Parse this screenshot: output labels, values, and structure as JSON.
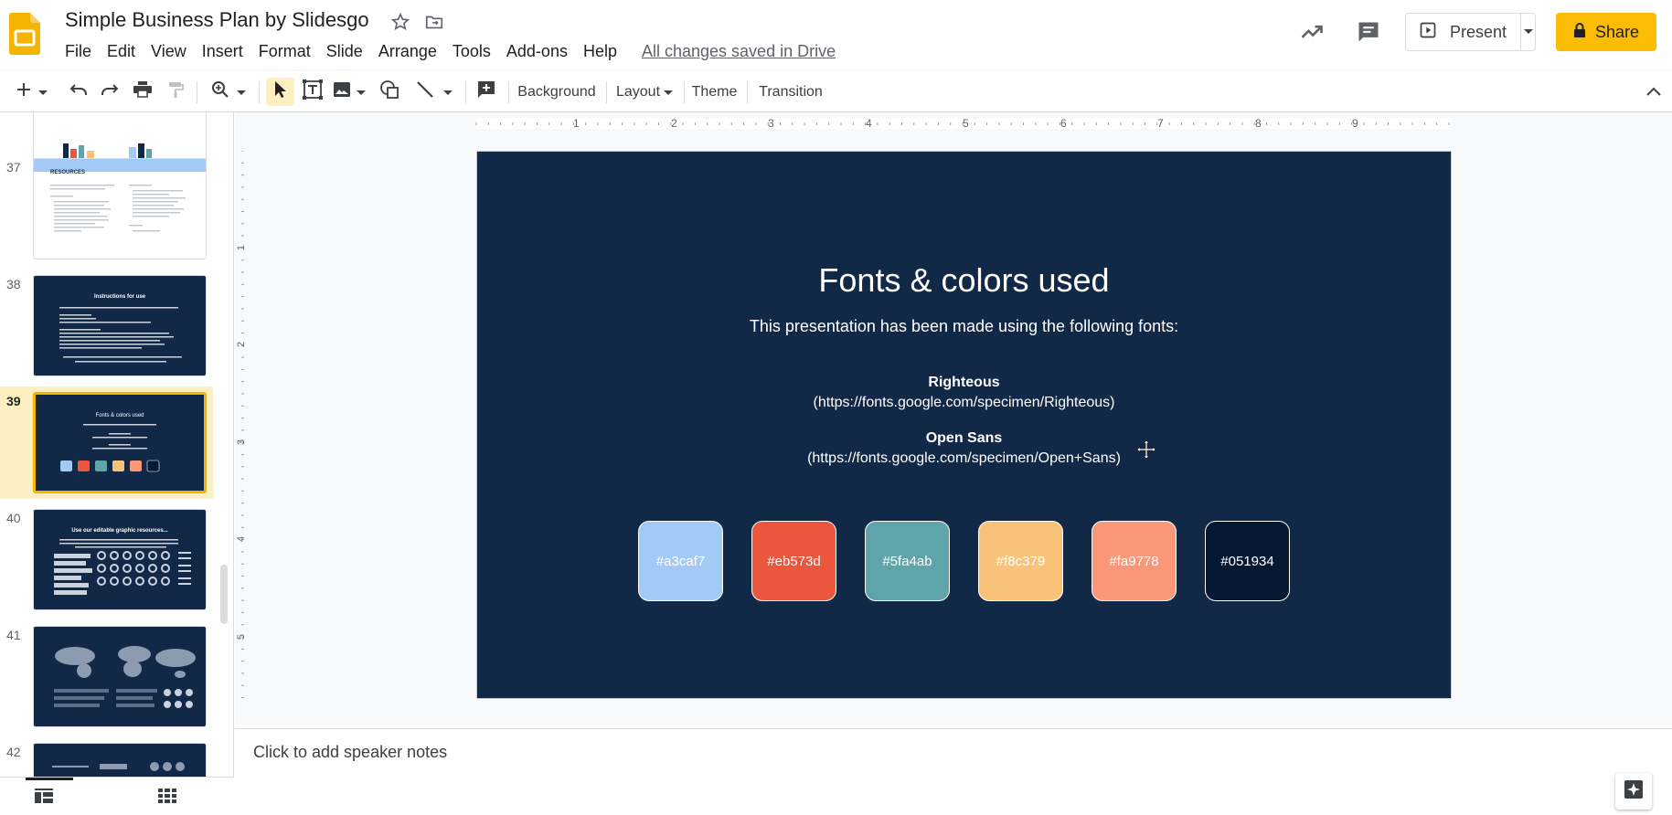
{
  "header": {
    "title": "Simple Business Plan by Slidesgo",
    "menu": [
      "File",
      "Edit",
      "View",
      "Insert",
      "Format",
      "Slide",
      "Arrange",
      "Tools",
      "Add-ons",
      "Help"
    ],
    "saved_status": "All changes saved in Drive",
    "present_label": "Present",
    "share_label": "Share"
  },
  "toolbar": {
    "background_label": "Background",
    "layout_label": "Layout",
    "theme_label": "Theme",
    "transition_label": "Transition"
  },
  "filmstrip": {
    "slides": [
      {
        "number": "37",
        "thumb_title": "RESOURCES"
      },
      {
        "number": "38",
        "thumb_title": "Instructions for use"
      },
      {
        "number": "39",
        "thumb_title": "Fonts & colors used",
        "selected": true
      },
      {
        "number": "40",
        "thumb_title": "Use our editable graphic resources..."
      },
      {
        "number": "41",
        "thumb_title": ""
      },
      {
        "number": "42",
        "thumb_title": ""
      }
    ]
  },
  "ruler": {
    "h_labels": [
      "1",
      "2",
      "3",
      "4",
      "5",
      "6",
      "7",
      "8",
      "9"
    ],
    "v_labels": [
      "1",
      "2",
      "3",
      "4",
      "5"
    ]
  },
  "slide": {
    "title": "Fonts & colors used",
    "subtitle": "This presentation has been made using the following fonts:",
    "fonts": [
      {
        "name": "Righteous",
        "url": "(https://fonts.google.com/specimen/Righteous)"
      },
      {
        "name": "Open Sans",
        "url": "(https://fonts.google.com/specimen/Open+Sans)"
      }
    ],
    "swatches": [
      {
        "label": "#a3caf7",
        "color": "#a3caf7"
      },
      {
        "label": "#eb573d",
        "color": "#eb573d"
      },
      {
        "label": "#5fa4ab",
        "color": "#5fa4ab"
      },
      {
        "label": "#f8c379",
        "color": "#f8c379"
      },
      {
        "label": "#fa9778",
        "color": "#fa9778"
      },
      {
        "label": "#051934",
        "color": "#051934"
      }
    ]
  },
  "notes": {
    "placeholder": "Click to add speaker notes"
  },
  "colors": {
    "accent": "#fbbc04",
    "slide_bg": "#122847",
    "selected_thumb_bg": "#feefc3"
  }
}
